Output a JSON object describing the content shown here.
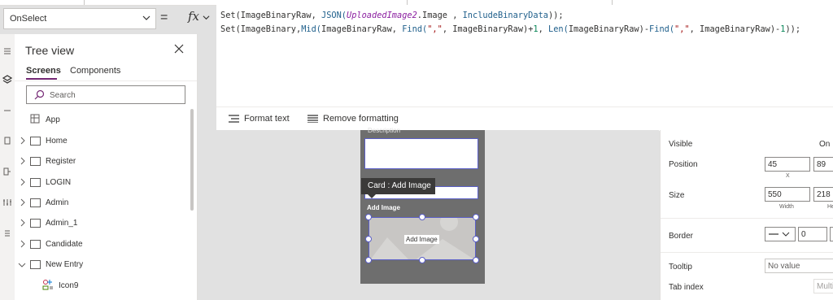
{
  "formula_bar": {
    "property": "OnSelect",
    "equals": "=",
    "fx": "fx",
    "line1": [
      {
        "t": "Set(ImageBinaryRaw, ",
        "c": "pl"
      },
      {
        "t": "JSON(",
        "c": "fn"
      },
      {
        "t": "UploadedImage2",
        "c": "it"
      },
      {
        "t": ".Image , ",
        "c": "pl"
      },
      {
        "t": "IncludeBinaryData",
        "c": "fn"
      },
      {
        "t": "));",
        "c": "pl"
      }
    ],
    "line2": [
      {
        "t": "Set(ImageBinary,",
        "c": "pl"
      },
      {
        "t": "Mid(",
        "c": "fn"
      },
      {
        "t": "ImageBinaryRaw, ",
        "c": "pl"
      },
      {
        "t": "Find(",
        "c": "fn"
      },
      {
        "t": "\",\"",
        "c": "str"
      },
      {
        "t": ", ImageBinaryRaw)+",
        "c": "pl"
      },
      {
        "t": "1",
        "c": "num"
      },
      {
        "t": ", ",
        "c": "pl"
      },
      {
        "t": "Len(",
        "c": "fn"
      },
      {
        "t": "ImageBinaryRaw)-",
        "c": "pl"
      },
      {
        "t": "Find(",
        "c": "fn"
      },
      {
        "t": "\",\"",
        "c": "str"
      },
      {
        "t": ", ImageBinaryRaw)-",
        "c": "pl"
      },
      {
        "t": "1",
        "c": "num"
      },
      {
        "t": "));",
        "c": "pl"
      }
    ],
    "toolbar": {
      "format_text": "Format text",
      "remove_formatting": "Remove formatting"
    }
  },
  "tree_view": {
    "title": "Tree view",
    "tabs": [
      "Screens",
      "Components"
    ],
    "search_placeholder": "Search",
    "items": [
      {
        "label": "App"
      },
      {
        "label": "Home"
      },
      {
        "label": "Register"
      },
      {
        "label": "LOGIN"
      },
      {
        "label": "Admin"
      },
      {
        "label": "Admin_1"
      },
      {
        "label": "Candidate"
      },
      {
        "label": "New Entry"
      },
      {
        "label": "Icon9"
      }
    ]
  },
  "canvas": {
    "top_label": "Description",
    "tooltip": "Card : Add Image",
    "add_image_label": "Add Image",
    "image_control_label": "Add Image"
  },
  "properties": {
    "visible_label": "Visible",
    "visible_value": "On",
    "position_label": "Position",
    "position_x": "45",
    "position_y": "89",
    "position_x_sub": "X",
    "size_label": "Size",
    "size_width": "550",
    "size_height": "218",
    "size_width_sub": "Width",
    "size_height_sub": "He",
    "border_label": "Border",
    "border_width": "0",
    "tooltip_label": "Tooltip",
    "tooltip_value": "No value",
    "tabindex_label": "Tab index",
    "tabindex_value": "Multi"
  },
  "colors": {
    "accent": "#742774",
    "selection": "#5b5fc7"
  }
}
